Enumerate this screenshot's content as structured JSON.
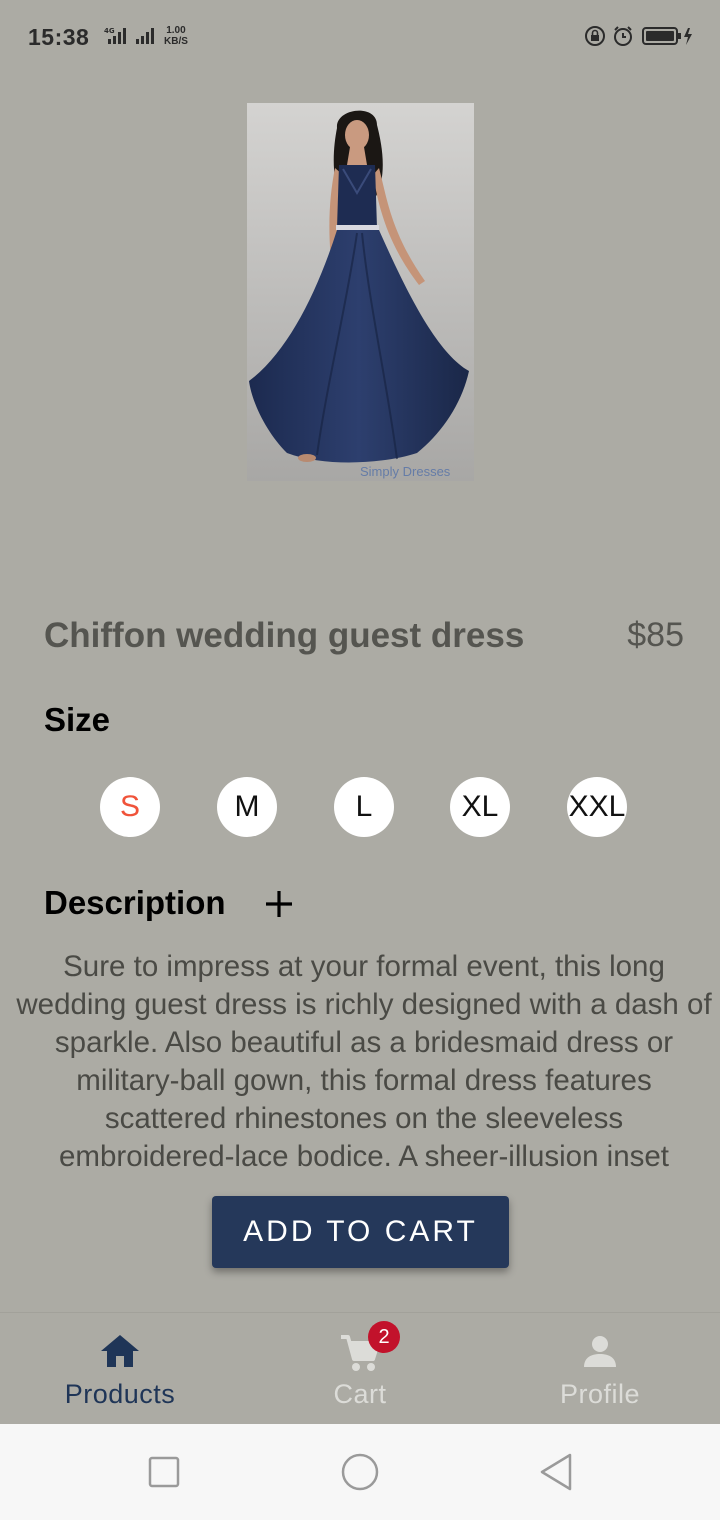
{
  "status_bar": {
    "time": "15:38",
    "network_type": "4G",
    "net_speed_value": "1.00",
    "net_speed_unit": "KB/S"
  },
  "product": {
    "image_watermark": "Simply Dresses",
    "title": "Chiffon wedding guest dress",
    "price": "$85",
    "size_heading": "Size",
    "sizes": [
      "S",
      "M",
      "L",
      "XL",
      "XXL"
    ],
    "selected_size": "S",
    "description_heading": "Description",
    "description": "Sure to impress at your formal event, this long wedding guest dress is richly designed with a dash of sparkle. Also beautiful as a bridesmaid dress or military-ball gown, this formal dress features scattered rhinestones on the sleeveless embroidered-lace bodice. A sheer-illusion inset",
    "add_to_cart_label": "ADD TO CART"
  },
  "bottom_nav": {
    "items": [
      {
        "label": "Products",
        "icon": "home-icon",
        "active": true
      },
      {
        "label": "Cart",
        "icon": "cart-icon",
        "badge": "2",
        "active": false
      },
      {
        "label": "Profile",
        "icon": "person-icon",
        "active": false
      }
    ]
  },
  "colors": {
    "background": "#acaba4",
    "accent": "#25385a",
    "selected_size": "#f0533a",
    "badge": "#c2122b"
  }
}
